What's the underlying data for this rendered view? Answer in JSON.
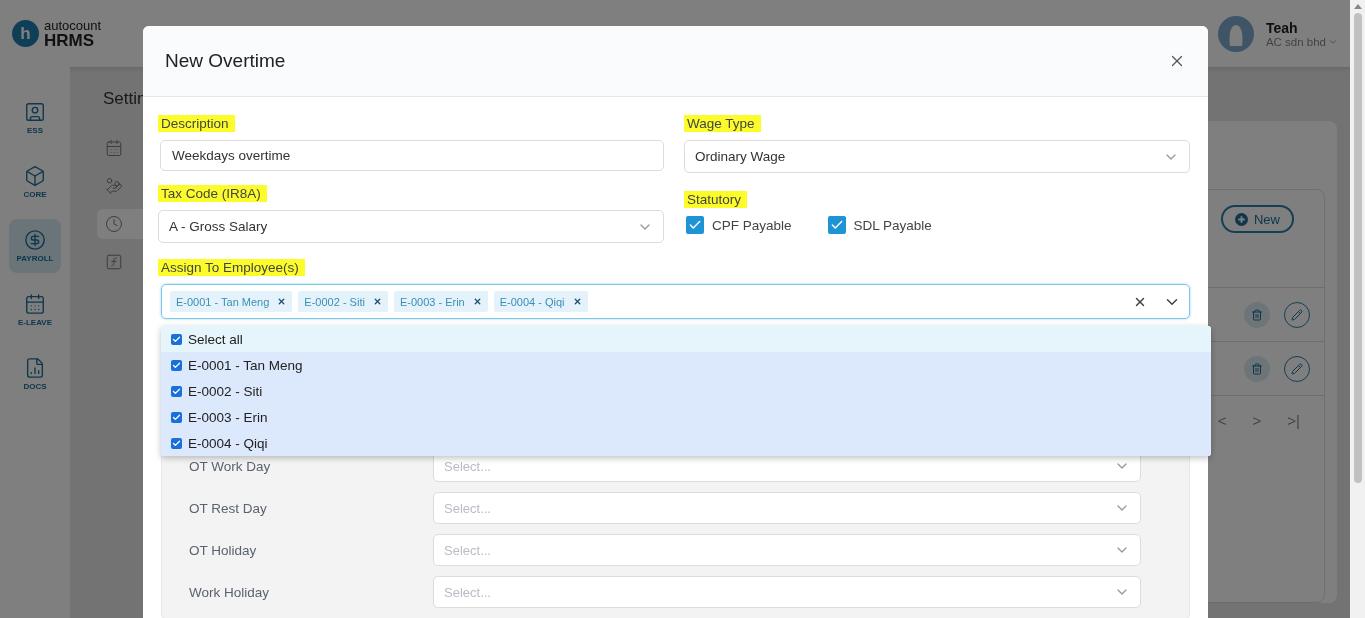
{
  "header": {
    "logo": {
      "mark": "h",
      "top": "autocount",
      "bottom": "HRMS"
    },
    "user": {
      "name": "Teah",
      "company": "AC sdn bhd"
    }
  },
  "sidebar": {
    "items": [
      {
        "label": "ESS",
        "selected": false
      },
      {
        "label": "CORE",
        "selected": false
      },
      {
        "label": "PAYROLL",
        "selected": true
      },
      {
        "label": "E-LEAVE",
        "selected": false
      },
      {
        "label": "DOCS",
        "selected": false
      }
    ]
  },
  "settings": {
    "title": "Settin",
    "menu": [
      {
        "selected": false
      },
      {
        "selected": false
      },
      {
        "selected": true
      },
      {
        "selected": false
      }
    ],
    "new_button": "New",
    "pagination": [
      "<",
      ">",
      ">|"
    ]
  },
  "modal": {
    "title": "New Overtime",
    "description": {
      "label": "Description",
      "value": "Weekdays overtime"
    },
    "wage_type": {
      "label": "Wage Type",
      "value": "Ordinary Wage"
    },
    "tax_code": {
      "label": "Tax Code (IR8A)",
      "value": "A - Gross Salary"
    },
    "statutory": {
      "label": "Statutory",
      "options": [
        {
          "label": "CPF Payable",
          "checked": true
        },
        {
          "label": "SDL Payable",
          "checked": true
        }
      ]
    },
    "assign": {
      "label": "Assign To Employee(s)",
      "chips": [
        "E-0001 - Tan Meng",
        "E-0002 - Siti",
        "E-0003 - Erin",
        "E-0004 - Qiqi"
      ],
      "options": [
        {
          "kind": "all",
          "label": "Select all",
          "checked": true
        },
        {
          "kind": "option",
          "label": "E-0001 - Tan Meng",
          "checked": true
        },
        {
          "kind": "option",
          "label": "E-0002 - Siti",
          "checked": true
        },
        {
          "kind": "option",
          "label": "E-0003 - Erin",
          "checked": true
        },
        {
          "kind": "option",
          "label": "E-0004 - Qiqi",
          "checked": true
        }
      ]
    },
    "rates": [
      {
        "label": "OT Work Day",
        "placeholder": "Select..."
      },
      {
        "label": "OT Rest Day",
        "placeholder": "Select..."
      },
      {
        "label": "OT Holiday",
        "placeholder": "Select..."
      },
      {
        "label": "Work Holiday",
        "placeholder": "Select..."
      }
    ]
  }
}
